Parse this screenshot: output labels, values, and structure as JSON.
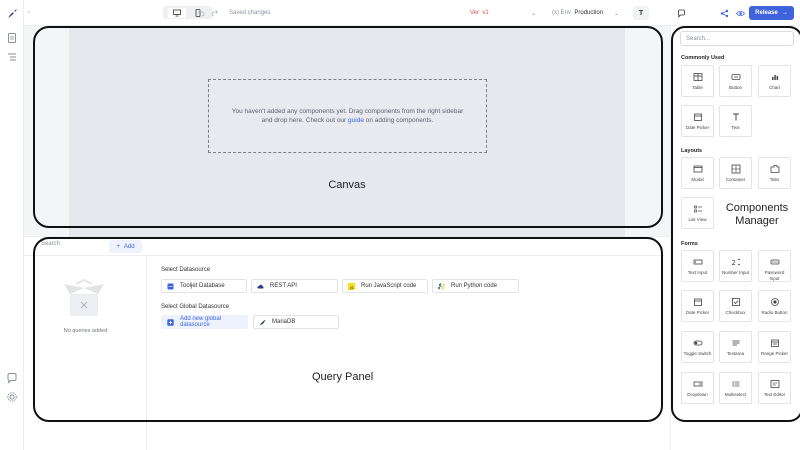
{
  "topbar": {
    "saved_status": "Saved changes",
    "version_prefix": "Ver",
    "version": "v1",
    "env_prefix": "(x) Env",
    "environment": "Production",
    "toggle_button": "T",
    "release_label": "Release"
  },
  "canvas": {
    "empty_line1": "You haven't added any components yet. Drag components from the right sidebar",
    "empty_line2_pre": "and drop here. Check out our",
    "empty_link": "guide",
    "empty_line2_post": "on adding components.",
    "label": "Canvas"
  },
  "query_panel": {
    "search_placeholder": "Search",
    "add_label": "Add",
    "no_queries": "No queries added",
    "select_datasource": "Select Datasource",
    "datasources": [
      {
        "label": "Tooljet Database",
        "icon": "database-icon"
      },
      {
        "label": "REST API",
        "icon": "cloud-icon"
      },
      {
        "label": "Run JavaScript code",
        "icon": "javascript-icon"
      },
      {
        "label": "Run Python code",
        "icon": "python-icon"
      }
    ],
    "select_global": "Select Global Datasource",
    "add_global": "Add new global datasource",
    "global_datasources": [
      {
        "label": "MariaDB",
        "icon": "mariadb-icon"
      }
    ],
    "label": "Query Panel"
  },
  "sidebar": {
    "search_placeholder": "Search...",
    "label": "Components Manager",
    "groups": [
      {
        "title": "Commonly Used",
        "items": [
          {
            "label": "Table",
            "icon": "table-icon"
          },
          {
            "label": "Button",
            "icon": "button-icon"
          },
          {
            "label": "Chart",
            "icon": "chart-icon"
          },
          {
            "label": "Date Picker",
            "icon": "calendar-icon"
          },
          {
            "label": "Text",
            "icon": "text-icon"
          }
        ]
      },
      {
        "title": "Layouts",
        "items": [
          {
            "label": "Modal",
            "icon": "modal-icon"
          },
          {
            "label": "Container",
            "icon": "container-icon"
          },
          {
            "label": "Tabs",
            "icon": "tabs-icon"
          },
          {
            "label": "List View",
            "icon": "list-icon"
          }
        ]
      },
      {
        "title": "Forms",
        "items": [
          {
            "label": "Text Input",
            "icon": "text-input-icon"
          },
          {
            "label": "Number Input",
            "icon": "number-input-icon"
          },
          {
            "label": "Password Input",
            "icon": "password-icon"
          },
          {
            "label": "Date Picker",
            "icon": "calendar-icon"
          },
          {
            "label": "Checkbox",
            "icon": "checkbox-icon"
          },
          {
            "label": "Radio Button",
            "icon": "radio-icon"
          },
          {
            "label": "Toggle Switch",
            "icon": "toggle-icon"
          },
          {
            "label": "Textarea",
            "icon": "textarea-icon"
          },
          {
            "label": "Range Picker",
            "icon": "range-picker-icon"
          },
          {
            "label": "Dropdown",
            "icon": "dropdown-icon"
          },
          {
            "label": "Multiselect",
            "icon": "multiselect-icon"
          },
          {
            "label": "Text Editor",
            "icon": "text-editor-icon"
          }
        ]
      }
    ]
  },
  "colors": {
    "accent": "#3e63dd",
    "version": "#d9534f",
    "canvas_bg": "#e6e8ee"
  }
}
